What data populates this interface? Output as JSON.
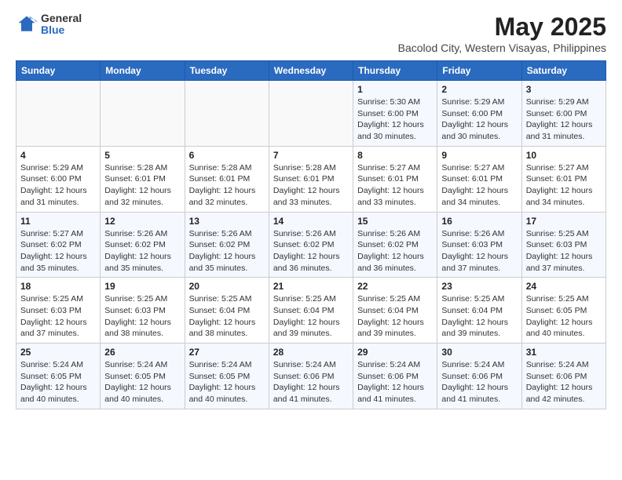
{
  "logo": {
    "general": "General",
    "blue": "Blue"
  },
  "title": "May 2025",
  "subtitle": "Bacolod City, Western Visayas, Philippines",
  "days_of_week": [
    "Sunday",
    "Monday",
    "Tuesday",
    "Wednesday",
    "Thursday",
    "Friday",
    "Saturday"
  ],
  "weeks": [
    [
      {
        "day": "",
        "info": ""
      },
      {
        "day": "",
        "info": ""
      },
      {
        "day": "",
        "info": ""
      },
      {
        "day": "",
        "info": ""
      },
      {
        "day": "1",
        "info": "Sunrise: 5:30 AM\nSunset: 6:00 PM\nDaylight: 12 hours\nand 30 minutes."
      },
      {
        "day": "2",
        "info": "Sunrise: 5:29 AM\nSunset: 6:00 PM\nDaylight: 12 hours\nand 30 minutes."
      },
      {
        "day": "3",
        "info": "Sunrise: 5:29 AM\nSunset: 6:00 PM\nDaylight: 12 hours\nand 31 minutes."
      }
    ],
    [
      {
        "day": "4",
        "info": "Sunrise: 5:29 AM\nSunset: 6:00 PM\nDaylight: 12 hours\nand 31 minutes."
      },
      {
        "day": "5",
        "info": "Sunrise: 5:28 AM\nSunset: 6:01 PM\nDaylight: 12 hours\nand 32 minutes."
      },
      {
        "day": "6",
        "info": "Sunrise: 5:28 AM\nSunset: 6:01 PM\nDaylight: 12 hours\nand 32 minutes."
      },
      {
        "day": "7",
        "info": "Sunrise: 5:28 AM\nSunset: 6:01 PM\nDaylight: 12 hours\nand 33 minutes."
      },
      {
        "day": "8",
        "info": "Sunrise: 5:27 AM\nSunset: 6:01 PM\nDaylight: 12 hours\nand 33 minutes."
      },
      {
        "day": "9",
        "info": "Sunrise: 5:27 AM\nSunset: 6:01 PM\nDaylight: 12 hours\nand 34 minutes."
      },
      {
        "day": "10",
        "info": "Sunrise: 5:27 AM\nSunset: 6:01 PM\nDaylight: 12 hours\nand 34 minutes."
      }
    ],
    [
      {
        "day": "11",
        "info": "Sunrise: 5:27 AM\nSunset: 6:02 PM\nDaylight: 12 hours\nand 35 minutes."
      },
      {
        "day": "12",
        "info": "Sunrise: 5:26 AM\nSunset: 6:02 PM\nDaylight: 12 hours\nand 35 minutes."
      },
      {
        "day": "13",
        "info": "Sunrise: 5:26 AM\nSunset: 6:02 PM\nDaylight: 12 hours\nand 35 minutes."
      },
      {
        "day": "14",
        "info": "Sunrise: 5:26 AM\nSunset: 6:02 PM\nDaylight: 12 hours\nand 36 minutes."
      },
      {
        "day": "15",
        "info": "Sunrise: 5:26 AM\nSunset: 6:02 PM\nDaylight: 12 hours\nand 36 minutes."
      },
      {
        "day": "16",
        "info": "Sunrise: 5:26 AM\nSunset: 6:03 PM\nDaylight: 12 hours\nand 37 minutes."
      },
      {
        "day": "17",
        "info": "Sunrise: 5:25 AM\nSunset: 6:03 PM\nDaylight: 12 hours\nand 37 minutes."
      }
    ],
    [
      {
        "day": "18",
        "info": "Sunrise: 5:25 AM\nSunset: 6:03 PM\nDaylight: 12 hours\nand 37 minutes."
      },
      {
        "day": "19",
        "info": "Sunrise: 5:25 AM\nSunset: 6:03 PM\nDaylight: 12 hours\nand 38 minutes."
      },
      {
        "day": "20",
        "info": "Sunrise: 5:25 AM\nSunset: 6:04 PM\nDaylight: 12 hours\nand 38 minutes."
      },
      {
        "day": "21",
        "info": "Sunrise: 5:25 AM\nSunset: 6:04 PM\nDaylight: 12 hours\nand 39 minutes."
      },
      {
        "day": "22",
        "info": "Sunrise: 5:25 AM\nSunset: 6:04 PM\nDaylight: 12 hours\nand 39 minutes."
      },
      {
        "day": "23",
        "info": "Sunrise: 5:25 AM\nSunset: 6:04 PM\nDaylight: 12 hours\nand 39 minutes."
      },
      {
        "day": "24",
        "info": "Sunrise: 5:25 AM\nSunset: 6:05 PM\nDaylight: 12 hours\nand 40 minutes."
      }
    ],
    [
      {
        "day": "25",
        "info": "Sunrise: 5:24 AM\nSunset: 6:05 PM\nDaylight: 12 hours\nand 40 minutes."
      },
      {
        "day": "26",
        "info": "Sunrise: 5:24 AM\nSunset: 6:05 PM\nDaylight: 12 hours\nand 40 minutes."
      },
      {
        "day": "27",
        "info": "Sunrise: 5:24 AM\nSunset: 6:05 PM\nDaylight: 12 hours\nand 40 minutes."
      },
      {
        "day": "28",
        "info": "Sunrise: 5:24 AM\nSunset: 6:06 PM\nDaylight: 12 hours\nand 41 minutes."
      },
      {
        "day": "29",
        "info": "Sunrise: 5:24 AM\nSunset: 6:06 PM\nDaylight: 12 hours\nand 41 minutes."
      },
      {
        "day": "30",
        "info": "Sunrise: 5:24 AM\nSunset: 6:06 PM\nDaylight: 12 hours\nand 41 minutes."
      },
      {
        "day": "31",
        "info": "Sunrise: 5:24 AM\nSunset: 6:06 PM\nDaylight: 12 hours\nand 42 minutes."
      }
    ]
  ]
}
